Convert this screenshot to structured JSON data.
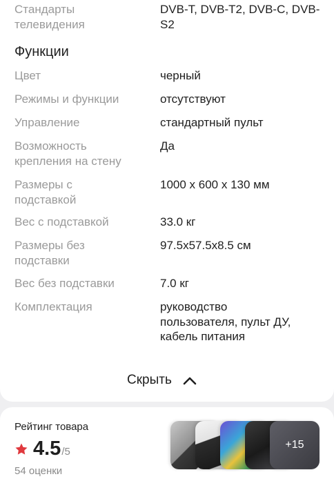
{
  "specs_top": {
    "key": "Стандарты\nтелевидения",
    "value": "DVB-T, DVB-T2, DVB-C, DVB-\nS2"
  },
  "section": {
    "title": "Функции"
  },
  "rows": [
    {
      "key": "Цвет",
      "value": "черный"
    },
    {
      "key": "Режимы и функции",
      "value": "отсутствуют"
    },
    {
      "key": "Управление",
      "value": "стандартный пульт"
    },
    {
      "key": "Возможность\nкрепления на стену",
      "value": "Да"
    },
    {
      "key": "Размеры с\nподставкой",
      "value": "1000 x 600 x 130 мм"
    },
    {
      "key": "Вес с подставкой",
      "value": "33.0 кг"
    },
    {
      "key": "Размеры без\nподставки",
      "value": "97.5x57.5x8.5 см"
    },
    {
      "key": "Вес без подставки",
      "value": "7.0 кг"
    },
    {
      "key": "Комплектация",
      "value": "руководство\nпользователя, пульт ДУ,\nкабель питания"
    }
  ],
  "hide_button": {
    "label": "Скрыть",
    "icon": "chevron-up-icon"
  },
  "rating": {
    "title": "Рейтинг товара",
    "value": "4.5",
    "max": "/5",
    "count": "54 оценки",
    "star_color": "#e0393e",
    "photos_more": "+15"
  }
}
